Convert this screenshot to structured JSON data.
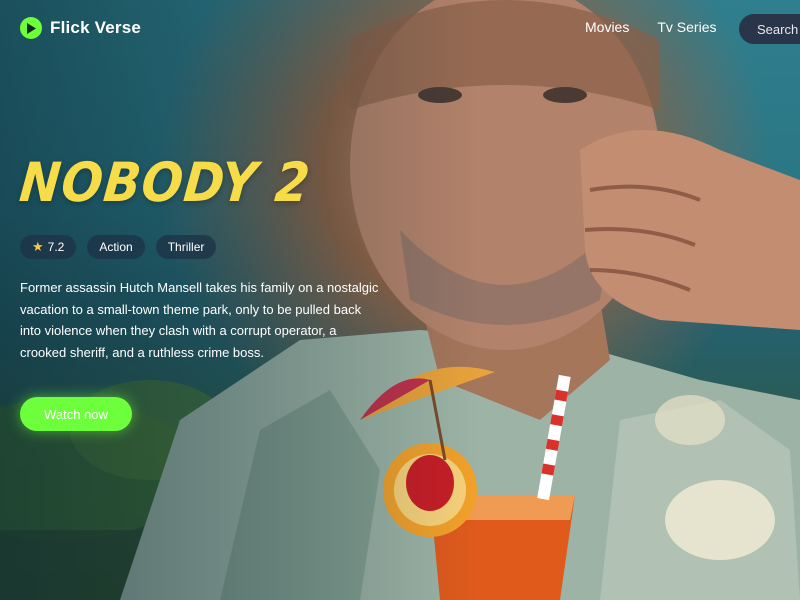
{
  "app": {
    "name": "Flick Verse"
  },
  "nav": {
    "movies": "Movies",
    "tv_series": "Tv Series"
  },
  "search": {
    "placeholder": "Search"
  },
  "hero": {
    "title": "NOBODY 2",
    "rating": "7.2",
    "genres": [
      "Action",
      "Thriller"
    ],
    "description": "Former assassin Hutch Mansell takes his family on a nostalgic vacation to a small-town theme park, only to be pulled back into violence when they clash with a corrupt operator, a crooked sheriff, and a ruthless crime boss.",
    "cta": "Watch now"
  },
  "colors": {
    "accent": "#6dff3b",
    "title": "#f7dc4a",
    "star": "#f7c948",
    "tag_bg": "#1e3246",
    "search_bg": "#28283c"
  },
  "icons": {
    "logo": "play-circle-icon",
    "rating": "star-icon"
  }
}
